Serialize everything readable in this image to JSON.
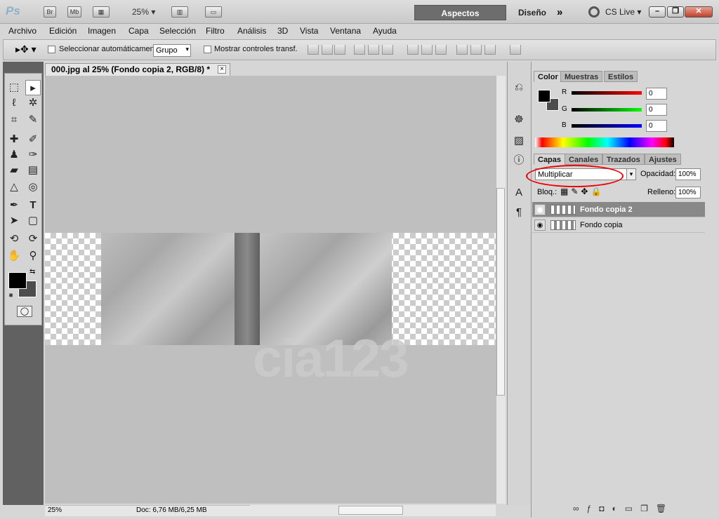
{
  "app": {
    "logo": "Ps",
    "btn_br": "Br",
    "btn_mb": "Mb",
    "zoom": "25%",
    "workspace_active": "Aspectos esenciales",
    "workspace_design": "Diseño",
    "cs_live": "CS Live",
    "more": "»"
  },
  "menu": [
    "Archivo",
    "Edición",
    "Imagen",
    "Capa",
    "Selección",
    "Filtro",
    "Análisis",
    "3D",
    "Vista",
    "Ventana",
    "Ayuda"
  ],
  "options": {
    "autoselect": "Seleccionar automáticamente:",
    "autoselect_value": "Grupo",
    "transform": "Mostrar controles transf."
  },
  "document": {
    "tab": "000.jpg al 25% (Fondo copia 2, RGB/8) *",
    "close": "×"
  },
  "status": {
    "zoom": "25%",
    "doc": "Doc: 6,76 MB/6,25 MB"
  },
  "color_panel": {
    "tabs": [
      "Color",
      "Muestras",
      "Estilos"
    ],
    "r": "0",
    "g": "0",
    "b": "0",
    "labels": [
      "R",
      "G",
      "B"
    ]
  },
  "layers_panel": {
    "tabs": [
      "Capas",
      "Canales",
      "Trazados",
      "Ajustes"
    ],
    "blend_mode": "Multiplicar",
    "opacity_label": "Opacidad:",
    "opacity": "100%",
    "lock_label": "Bloq.:",
    "fill_label": "Relleno:",
    "fill": "100%",
    "layers": [
      {
        "name": "Fondo copia 2",
        "selected": true
      },
      {
        "name": "Fondo copia",
        "selected": false
      }
    ]
  },
  "watermark": "cia123",
  "colors": {
    "accent_red": "#e00000",
    "selected_layer": "#888888",
    "foreground": "#000000",
    "background": "#4d4d4d"
  }
}
